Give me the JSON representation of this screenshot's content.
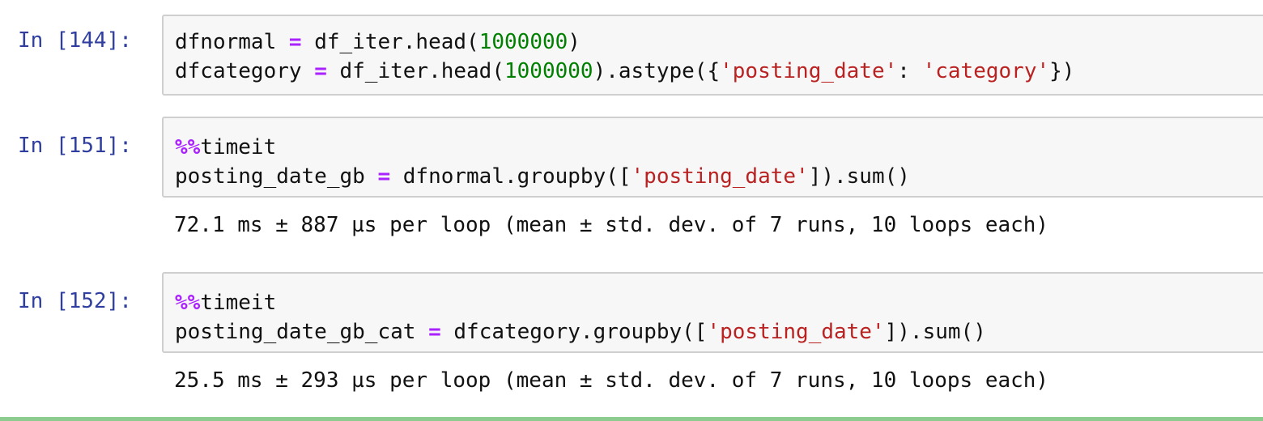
{
  "cells": [
    {
      "prompt": "In [144]:",
      "lines": [
        [
          {
            "t": "dfnormal ",
            "c": "plain"
          },
          {
            "t": "=",
            "c": "op"
          },
          {
            "t": " df_iter.head(",
            "c": "plain"
          },
          {
            "t": "1000000",
            "c": "num"
          },
          {
            "t": ")",
            "c": "plain"
          }
        ],
        [
          {
            "t": "dfcategory ",
            "c": "plain"
          },
          {
            "t": "=",
            "c": "op"
          },
          {
            "t": " df_iter.head(",
            "c": "plain"
          },
          {
            "t": "1000000",
            "c": "num"
          },
          {
            "t": ").astype({",
            "c": "plain"
          },
          {
            "t": "'posting_date'",
            "c": "str"
          },
          {
            "t": ": ",
            "c": "plain"
          },
          {
            "t": "'category'",
            "c": "str"
          },
          {
            "t": "})",
            "c": "plain"
          }
        ]
      ],
      "output": ""
    },
    {
      "prompt": "In [151]:",
      "lines": [
        [
          {
            "t": "%%",
            "c": "magic"
          },
          {
            "t": "timeit",
            "c": "plain"
          }
        ],
        [
          {
            "t": "posting_date_gb ",
            "c": "plain"
          },
          {
            "t": "=",
            "c": "op"
          },
          {
            "t": " dfnormal.groupby([",
            "c": "plain"
          },
          {
            "t": "'posting_date'",
            "c": "str"
          },
          {
            "t": "]).sum()",
            "c": "plain"
          }
        ]
      ],
      "output": "72.1 ms ± 887 µs per loop (mean ± std. dev. of 7 runs, 10 loops each)"
    },
    {
      "prompt": "In [152]:",
      "lines": [
        [
          {
            "t": "%%",
            "c": "magic"
          },
          {
            "t": "timeit",
            "c": "plain"
          }
        ],
        [
          {
            "t": "posting_date_gb_cat ",
            "c": "plain"
          },
          {
            "t": "=",
            "c": "op"
          },
          {
            "t": " dfcategory.groupby([",
            "c": "plain"
          },
          {
            "t": "'posting_date'",
            "c": "str"
          },
          {
            "t": "]).sum()",
            "c": "plain"
          }
        ]
      ],
      "output": "25.5 ms ± 293 µs per loop (mean ± std. dev. of 7 runs, 10 loops each)"
    }
  ],
  "colors": {
    "prompt": "#303f9f",
    "operator": "#aa22ff",
    "number": "#008000",
    "string": "#ba2121",
    "cell_bg": "#f7f7f7",
    "cell_border": "#cfcfcf",
    "selected_bar": "#66bb6a"
  }
}
